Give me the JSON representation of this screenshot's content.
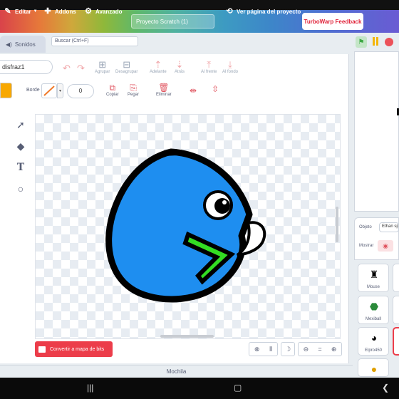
{
  "menu": {
    "edit": "Editar",
    "addons": "Addons",
    "advanced": "Avanzado",
    "project_title": "Proyecto Scratch (1)",
    "view_project": "Ver página del proyecto",
    "feedback": "TurboWarp Feedback"
  },
  "tabs": {
    "sounds": "Sonidos"
  },
  "search": {
    "placeholder": "Buscar (Ctrl+F)"
  },
  "costume": {
    "name": "disfraz1"
  },
  "toolbar": {
    "group": "Agrupar",
    "ungroup": "Desagrupar",
    "forward": "Adelante",
    "backward": "Atrás",
    "front": "Al frente",
    "back": "Al fondo"
  },
  "props": {
    "outline_label": "Borde",
    "outline_width": "0",
    "fill_color": "#f8a800",
    "copy": "Copiar",
    "paste": "Pegar",
    "delete": "Eliminar"
  },
  "canvas": {
    "convert": "Convertir a mapa de bits",
    "zoom_reset": "="
  },
  "backpack": {
    "label": "Mochila"
  },
  "sprite_info": {
    "sprite_label": "Objeto",
    "sprite_name": "Ethan sp",
    "show_label": "Mostrar"
  },
  "sprites": [
    {
      "name": "Mouse",
      "icon": "mouse-icon"
    },
    {
      "name": "Mexiball",
      "icon": "mexiball-icon"
    },
    {
      "name": "Elpro450",
      "icon": "elpro-icon"
    }
  ],
  "colors": {
    "accent": "#ec3d4a",
    "character_blue": "#1e8ef0",
    "beak_green": "#33dd22"
  }
}
